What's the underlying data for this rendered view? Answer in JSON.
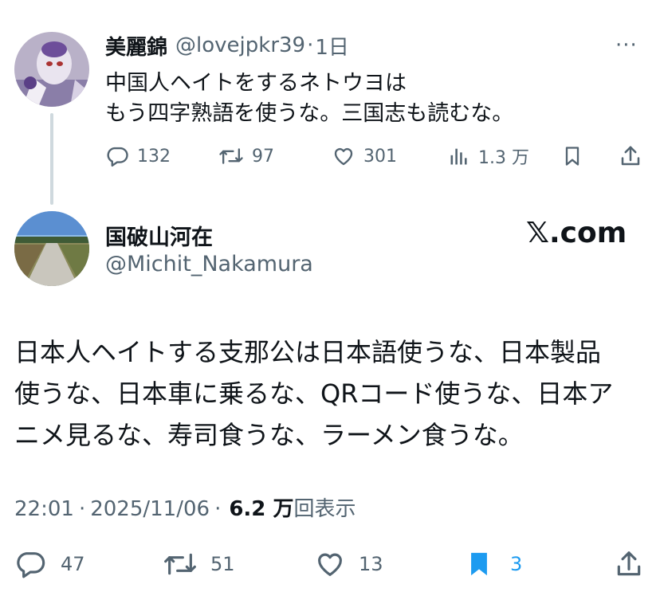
{
  "parent_tweet": {
    "display_name": "美麗錦",
    "handle": "@lovejpkr39",
    "separator": "·",
    "time": "1日",
    "more_label": "···",
    "avatar_icon": "anime-character-avatar",
    "text_lines": [
      "中国人ヘイトをするネトウヨは",
      "もう四字熟語を使うな。三国志も読むな。"
    ],
    "actions": {
      "replies": "132",
      "retweets": "97",
      "likes": "301",
      "views": "1.3 万"
    }
  },
  "main_tweet": {
    "display_name": "国破山河在",
    "handle": "@Michit_Nakamura",
    "avatar_icon": "road-landscape-avatar",
    "text_lines": [
      "日本人ヘイトする支那公は日本語使うな、日本製品",
      "使うな、日本車に乗るな、QRコード使うな、日本ア",
      "ニメ見るな、寿司食うな、ラーメン食うな。"
    ],
    "meta": {
      "time": "22:01",
      "separator": "·",
      "date": "2025/11/06",
      "dot": "·",
      "views_count": "6.2 万",
      "views_label": "回表示"
    },
    "actions": {
      "replies": "47",
      "retweets": "51",
      "likes": "13",
      "bookmarks": "3"
    }
  },
  "brand": {
    "text": "𝕏.com"
  },
  "colors": {
    "text": "#0f1419",
    "secondary": "#536471",
    "accent": "#1d9bf0",
    "thread_line": "#cfd9de"
  }
}
